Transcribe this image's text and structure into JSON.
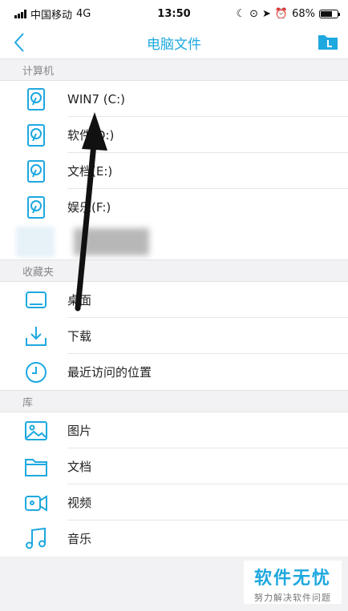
{
  "status_bar": {
    "carrier": "中国移动",
    "network": "4G",
    "time": "13:50",
    "battery": "68%",
    "battery_level": 0.68
  },
  "nav": {
    "title": "电脑文件",
    "back_icon": "chevron-left-icon",
    "action_icon": "folder-icon"
  },
  "sections": {
    "computer": {
      "header": "计算机",
      "items": [
        {
          "label": "WIN7 (C:)",
          "icon": "hard-drive-icon"
        },
        {
          "label": "软件(D:)",
          "icon": "hard-drive-icon"
        },
        {
          "label": "文档(E:)",
          "icon": "hard-drive-icon"
        },
        {
          "label": "娱乐(F:)",
          "icon": "hard-drive-icon"
        }
      ]
    },
    "favorites": {
      "header": "收藏夹",
      "items": [
        {
          "label": "桌面",
          "icon": "desktop-icon"
        },
        {
          "label": "下载",
          "icon": "download-icon"
        },
        {
          "label": "最近访问的位置",
          "icon": "clock-icon"
        }
      ]
    },
    "library": {
      "header": "库",
      "items": [
        {
          "label": "图片",
          "icon": "image-icon"
        },
        {
          "label": "文档",
          "icon": "folder-icon"
        },
        {
          "label": "视频",
          "icon": "video-icon"
        },
        {
          "label": "音乐",
          "icon": "music-icon"
        }
      ]
    }
  },
  "watermark": {
    "title": "软件无忧",
    "subtitle": "努力解决软件问题"
  },
  "colors": {
    "accent": "#1ea8df",
    "background": "#f2f2f5"
  }
}
